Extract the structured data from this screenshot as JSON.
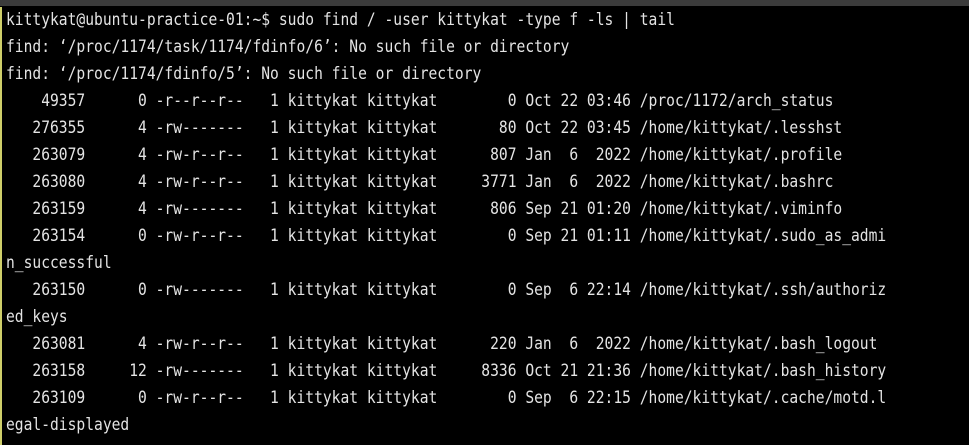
{
  "terminal": {
    "colors": {
      "background": "#000000",
      "text": "#e4e4e4",
      "titlebar": "#3b3b3b"
    },
    "lines": [
      "kittykat@ubuntu-practice-01:~$ sudo find / -user kittykat -type f -ls | tail",
      "find: ‘/proc/1174/task/1174/fdinfo/6’: No such file or directory",
      "find: ‘/proc/1174/fdinfo/5’: No such file or directory",
      "    49357      0 -r--r--r--   1 kittykat kittykat        0 Oct 22 03:46 /proc/1172/arch_status",
      "   276355      4 -rw-------   1 kittykat kittykat       80 Oct 22 03:45 /home/kittykat/.lesshst",
      "   263079      4 -rw-r--r--   1 kittykat kittykat      807 Jan  6  2022 /home/kittykat/.profile",
      "   263080      4 -rw-r--r--   1 kittykat kittykat     3771 Jan  6  2022 /home/kittykat/.bashrc",
      "   263159      4 -rw-------   1 kittykat kittykat      806 Sep 21 01:20 /home/kittykat/.viminfo",
      "   263154      0 -rw-r--r--   1 kittykat kittykat        0 Sep 21 01:11 /home/kittykat/.sudo_as_admi",
      "n_successful",
      "   263150      0 -rw-------   1 kittykat kittykat        0 Sep  6 22:14 /home/kittykat/.ssh/authoriz",
      "ed_keys",
      "   263081      4 -rw-r--r--   1 kittykat kittykat      220 Jan  6  2022 /home/kittykat/.bash_logout",
      "   263158     12 -rw-------   1 kittykat kittykat     8336 Oct 21 21:36 /home/kittykat/.bash_history",
      "   263109      0 -rw-r--r--   1 kittykat kittykat        0 Sep  6 22:15 /home/kittykat/.cache/motd.l",
      "egal-displayed"
    ]
  }
}
